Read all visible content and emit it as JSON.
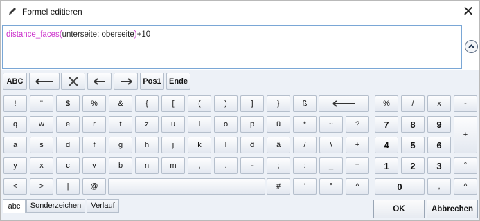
{
  "window": {
    "title": "Formel editieren"
  },
  "formula": {
    "function": "distance_faces",
    "open": "(",
    "args": "unterseite; oberseite",
    "close": ")",
    "suffix": "+10"
  },
  "toolbar": {
    "abc": "ABC",
    "pos1": "Pos1",
    "ende": "Ende"
  },
  "keys": {
    "r1": [
      "!",
      "\"",
      "$",
      "%",
      "&",
      "{",
      "[",
      "(",
      ")",
      "]",
      "}",
      "ß"
    ],
    "r2": [
      "q",
      "w",
      "e",
      "r",
      "t",
      "z",
      "u",
      "i",
      "o",
      "p",
      "ü",
      "*",
      "~",
      "?"
    ],
    "r3": [
      "a",
      "s",
      "d",
      "f",
      "g",
      "h",
      "j",
      "k",
      "l",
      "ö",
      "ä",
      "/",
      "\\",
      "+"
    ],
    "r4": [
      "y",
      "x",
      "c",
      "v",
      "b",
      "n",
      "m",
      ",",
      ".",
      "-",
      ";",
      ":",
      "_",
      "="
    ],
    "r5": [
      "<",
      ">",
      "|",
      "@",
      "#",
      "'",
      "°",
      "^"
    ],
    "numpad": {
      "r1": [
        "%",
        "/",
        "x",
        "-"
      ],
      "r2": [
        "7",
        "8",
        "9"
      ],
      "r3": [
        "4",
        "5",
        "6"
      ],
      "r4": [
        "1",
        "2",
        "3",
        "°"
      ],
      "r5": [
        "0",
        ",",
        "^"
      ],
      "plus": "+"
    }
  },
  "tabs": [
    "abc",
    "Sonderzeichen",
    "Verlauf"
  ],
  "buttons": {
    "ok": "OK",
    "cancel": "Abbrechen"
  }
}
